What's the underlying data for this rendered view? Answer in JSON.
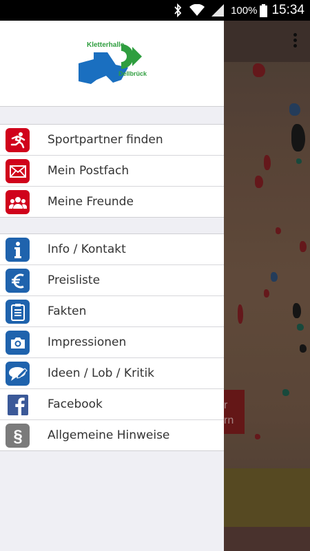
{
  "status_bar": {
    "battery_percent": "100%",
    "time": "15:34",
    "icons": [
      "bluetooth-icon",
      "wifi-icon",
      "signal-icon",
      "battery-icon"
    ]
  },
  "drawer": {
    "logo": {
      "top_text": "Kletterhalle",
      "bottom_text": "Dellbrück"
    },
    "groups": [
      {
        "items": [
          {
            "label": "Sportpartner finden",
            "icon": "runner-icon",
            "color": "#d0021b"
          },
          {
            "label": "Mein Postfach",
            "icon": "envelope-icon",
            "color": "#d0021b"
          },
          {
            "label": "Meine Freunde",
            "icon": "people-icon",
            "color": "#d0021b"
          }
        ]
      },
      {
        "items": [
          {
            "label": "Info / Kontakt",
            "icon": "info-icon",
            "color": "#1f63ad"
          },
          {
            "label": "Preisliste",
            "icon": "euro-icon",
            "color": "#1f63ad"
          },
          {
            "label": "Fakten",
            "icon": "clipboard-icon",
            "color": "#1f63ad"
          },
          {
            "label": "Impressionen",
            "icon": "camera-icon",
            "color": "#1f63ad"
          },
          {
            "label": "Ideen / Lob / Kritik",
            "icon": "chat-pencil-icon",
            "color": "#1f63ad"
          },
          {
            "label": "Facebook",
            "icon": "facebook-icon",
            "color": "#3b5998"
          },
          {
            "label": "Allgemeine Hinweise",
            "icon": "paragraph-icon",
            "color": "#7b7b7b"
          }
        ]
      }
    ]
  },
  "background": {
    "button_text_1": "r",
    "button_text_2": "rn"
  }
}
